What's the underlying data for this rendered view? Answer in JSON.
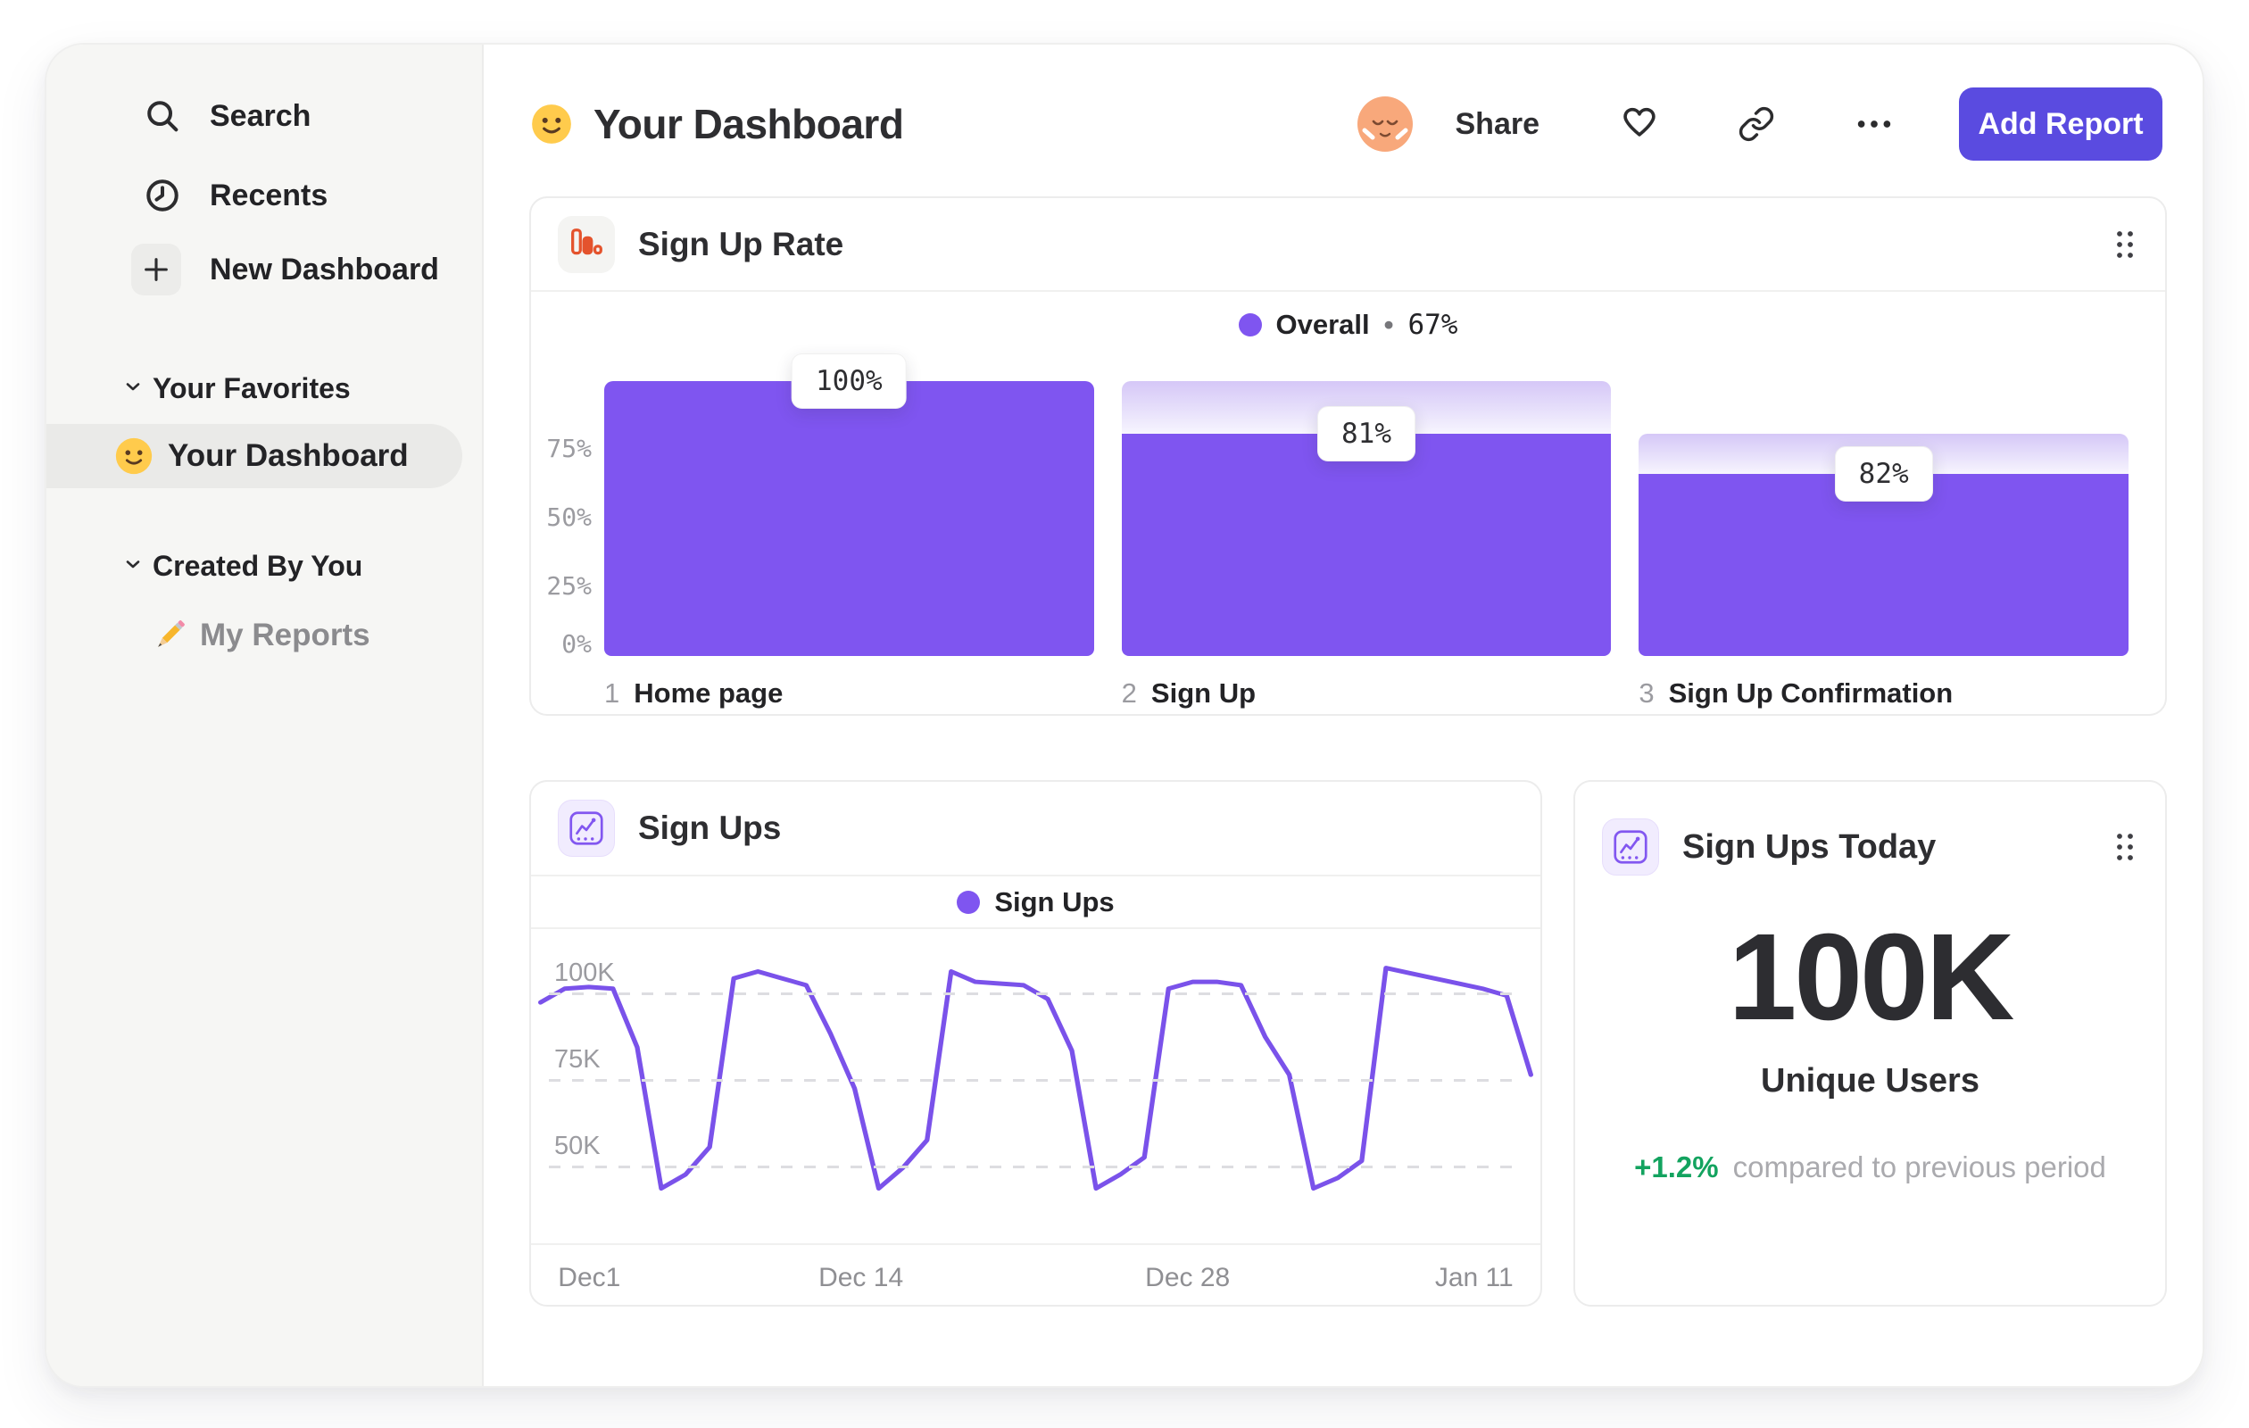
{
  "theme": {
    "accent_purple": "#7F55F0",
    "line_purple": "#7A52EA",
    "button_indigo": "#5A4BE0",
    "positive_green": "#13A35F",
    "funnel_icon_orange": "#E4532D",
    "avatar_peach": "#F8A87B",
    "emoji_yellow": "#FFCB4C"
  },
  "sidebar": {
    "items": [
      {
        "label": "Search",
        "icon": "search-icon"
      },
      {
        "label": "Recents",
        "icon": "clock-icon"
      },
      {
        "label": "New Dashboard",
        "icon": "plus-icon"
      }
    ],
    "sections": [
      {
        "title": "Your Favorites",
        "items": [
          {
            "label": "Your Dashboard",
            "icon": "smiley-emoji",
            "selected": true
          }
        ]
      },
      {
        "title": "Created By You",
        "items": [
          {
            "label": "My Reports",
            "icon": "pencil-emoji",
            "selected": false
          }
        ]
      }
    ]
  },
  "header": {
    "title": "Your Dashboard",
    "emoji": "smiley-emoji",
    "share_label": "Share",
    "add_report_label": "Add Report"
  },
  "funnel_card": {
    "title": "Sign Up Rate",
    "legend_label": "Overall",
    "legend_separator": "•",
    "legend_value": "67%"
  },
  "line_card": {
    "title": "Sign Ups",
    "legend_label": "Sign Ups"
  },
  "stat_card": {
    "title": "Sign Ups Today",
    "value": "100K",
    "caption": "Unique Users",
    "delta": "+1.2%",
    "delta_caption": "compared to previous period"
  },
  "chart_data": [
    {
      "type": "bar",
      "name": "sign-up-rate-funnel",
      "title": "Sign Up Rate",
      "legend": "Overall • 67%",
      "categories": [
        "Home page",
        "Sign Up",
        "Sign Up Confirmation"
      ],
      "values": [
        100,
        81,
        82
      ],
      "value_meaning": "conversion from previous step, %",
      "absolute_heights_pct": [
        100,
        81,
        66.4
      ],
      "bar_labels": [
        "100%",
        "81%",
        "82%"
      ],
      "yticks_pct": [
        0,
        25,
        50,
        75
      ],
      "ylim_pct": [
        0,
        100
      ],
      "grid": false,
      "steps": [
        {
          "index": "1",
          "name": "Home page",
          "label": "100%",
          "height_pct": 100,
          "prev_pct": 100
        },
        {
          "index": "2",
          "name": "Sign Up",
          "label": "81%",
          "height_pct": 81,
          "prev_pct": 100
        },
        {
          "index": "3",
          "name": "Sign Up Confirmation",
          "label": "82%",
          "height_pct": 66.4,
          "prev_pct": 81
        }
      ]
    },
    {
      "type": "line",
      "name": "sign-ups-over-time",
      "title": "Sign Ups",
      "legend_entries": [
        "Sign Ups"
      ],
      "legend_position": "top-center",
      "y_grid": "dashed",
      "y_ticks": [
        {
          "label": "100K",
          "value_k": 100
        },
        {
          "label": "75K",
          "value_k": 75
        },
        {
          "label": "50K",
          "value_k": 50
        }
      ],
      "x_ticks": [
        {
          "label": "Dec1",
          "pos": 0
        },
        {
          "label": "Dec 14",
          "pos": 0.317
        },
        {
          "label": "Dec 28",
          "pos": 0.659
        },
        {
          "label": "Jan 11",
          "pos": 1
        }
      ],
      "series": [
        {
          "name": "Sign Ups",
          "unit": "K users",
          "values_k": [
            97,
            101,
            101.5,
            101,
            84,
            43,
            47,
            55,
            104,
            106,
            104,
            102,
            88,
            72,
            43,
            49,
            57,
            106,
            103,
            102.5,
            102,
            98,
            83,
            43,
            47,
            52,
            101,
            103,
            103,
            102,
            87,
            76,
            43,
            46,
            51,
            107,
            105.5,
            104,
            102.5,
            101,
            99,
            76
          ]
        }
      ]
    }
  ]
}
